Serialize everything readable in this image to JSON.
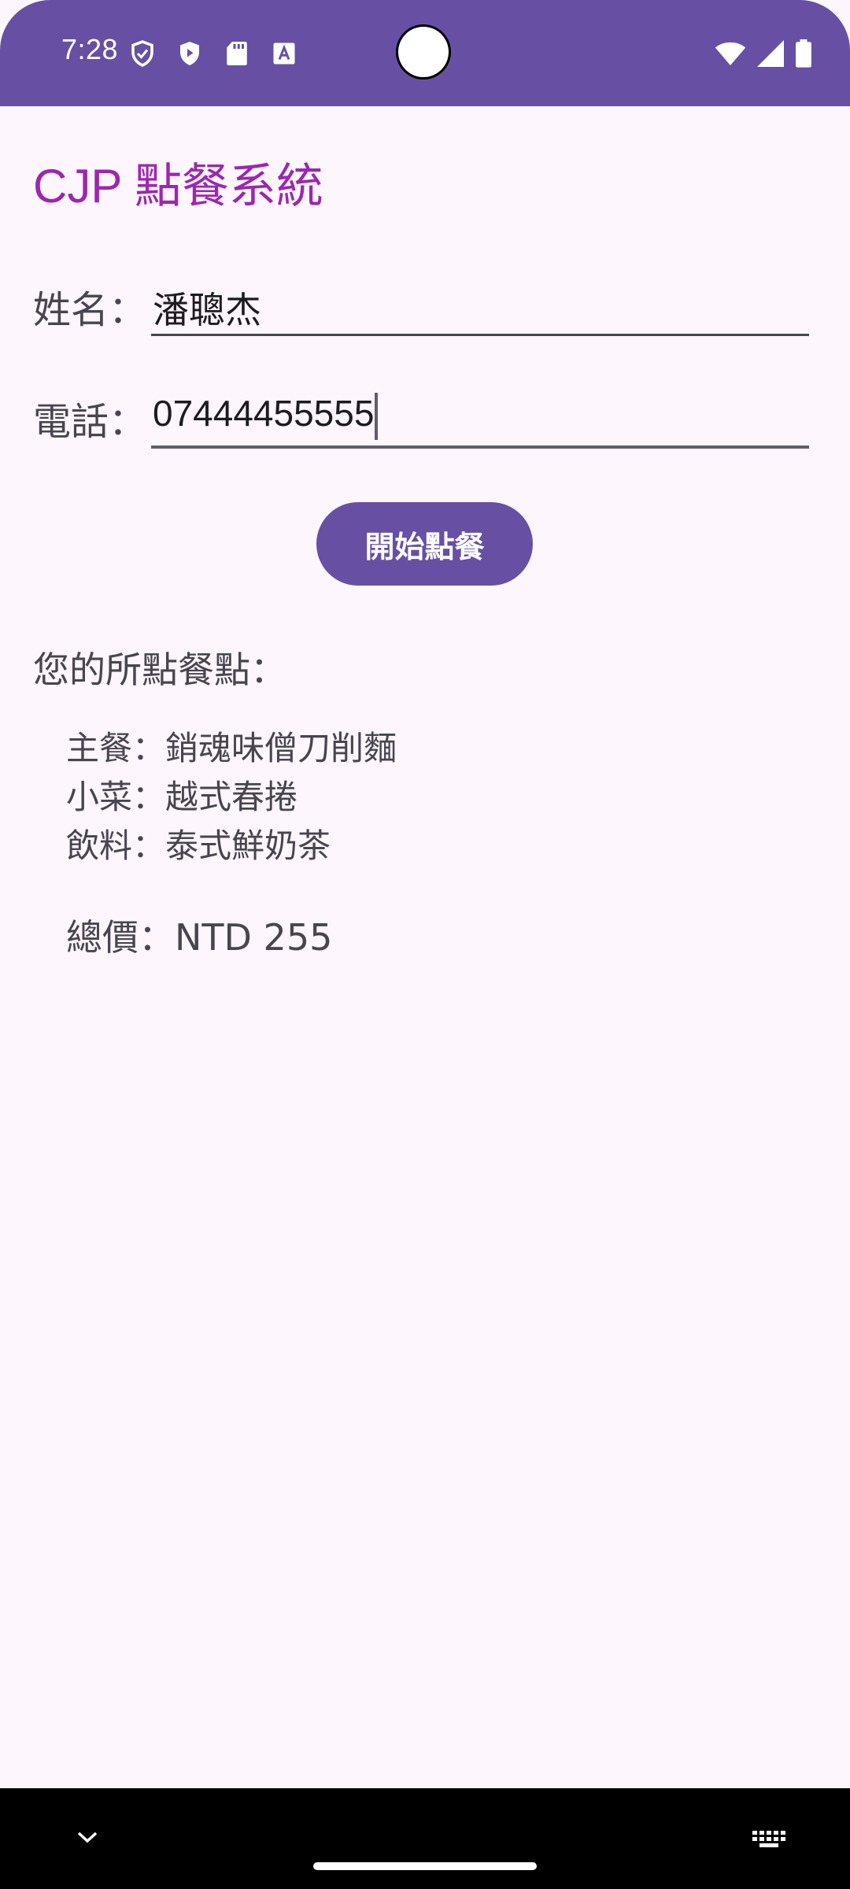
{
  "status_bar": {
    "time": "7:28",
    "left_icons": [
      "shield-outline-icon",
      "play-protect-icon",
      "sd-card-icon",
      "text-a-icon"
    ],
    "right_icons": [
      "wifi-icon",
      "cell-signal-icon",
      "battery-icon"
    ],
    "background": "#6750a4"
  },
  "app": {
    "title": "CJP 點餐系統",
    "title_color": "#9c27b0"
  },
  "form": {
    "name_label": "姓名：",
    "name_value": "潘聰杰",
    "phone_label": "電話：",
    "phone_value": "07444455555"
  },
  "start_button": {
    "label": "開始點餐",
    "color": "#6750a4"
  },
  "order": {
    "heading": "您的所點餐點：",
    "items": [
      {
        "category": "主餐：",
        "name": "銷魂味僧刀削麵"
      },
      {
        "category": "小菜：",
        "name": "越式春捲"
      },
      {
        "category": "飲料：",
        "name": "泰式鮮奶茶"
      }
    ],
    "total_label": "總價：",
    "total_value": "NTD 255"
  },
  "nav_bar": {
    "icons": [
      "chevron-down-icon",
      "keyboard-icon"
    ]
  }
}
